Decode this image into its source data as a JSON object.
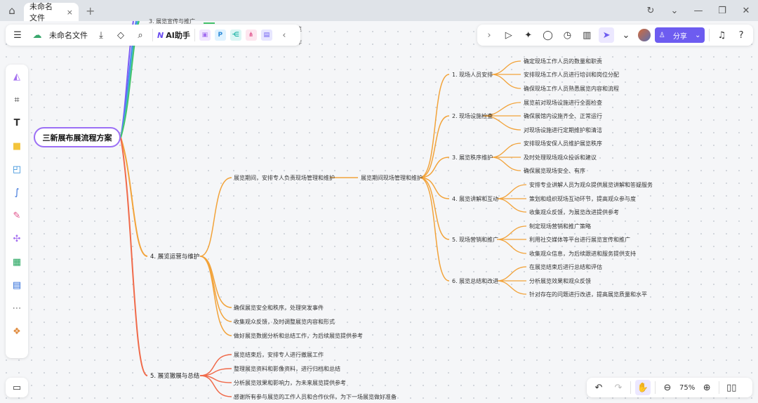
{
  "browser": {
    "tab_title": "未命名文件",
    "close_glyph": "×",
    "new_tab_glyph": "+"
  },
  "toolbar_left": {
    "menu_icon": "menu-icon",
    "file_title": "未命名文件",
    "ai_label": "AI助手",
    "ai_logo": "N"
  },
  "toolbar_right": {
    "share_label": "分享"
  },
  "zoom": {
    "level": "75%"
  },
  "mindmap": {
    "root": "三新展布展流程方案",
    "clipped": {
      "top_item_1": "3. 展览宣传与推广",
      "top_item_2_suffix": "览",
      "top_item_3_suffix": "作"
    },
    "branch4": {
      "label": "4. 展览运营与维护",
      "child_main": "展览期间，安排专人负责现场管理和维护",
      "child_mid": "展览期间现场管理和维护",
      "extra_children": [
        "确保展览安全和秩序，处理突发事件",
        "收集观众反馈，及时调整展览内容和形式",
        "做好展览数据分析和总结工作，为后续展览提供参考"
      ],
      "subsections": [
        {
          "label": "1. 现场人员安排",
          "items": [
            "确定现场工作人员的数量和职责",
            "安排现场工作人员进行培训和岗位分配",
            "确保现场工作人员熟悉展览内容和流程"
          ]
        },
        {
          "label": "2. 现场设施检查",
          "items": [
            "展览前对现场设施进行全面检查",
            "确保展馆内设施齐全、正常运行",
            "对现场设施进行定期维护和清洁"
          ]
        },
        {
          "label": "3. 展览秩序维护",
          "items": [
            "安排现场安保人员维护展览秩序",
            "及时处理现场观众投诉和建议",
            "确保展览现场安全、有序"
          ]
        },
        {
          "label": "4. 展览讲解和互动",
          "items": [
            "安排专业讲解人员为观众提供展览讲解和答疑服务",
            "策划和组织现场互动环节，提高观众参与度",
            "收集观众反馈，为展览改进提供参考"
          ]
        },
        {
          "label": "5. 现场营销和推广",
          "items": [
            "制定现场营销和推广策略",
            "利用社交媒体等平台进行展览宣传和推广",
            "收集观众信息，为后续跟进和服务提供支持"
          ]
        },
        {
          "label": "6. 展览总结和改进",
          "items": [
            "在展览结束后进行总结和评估",
            "分析展览效果和观众反馈",
            "针对存在的问题进行改进，提高展览质量和水平"
          ]
        }
      ]
    },
    "branch5": {
      "label": "5. 展览撤展与总结",
      "children": [
        "展览结束后，安排专人进行撤展工作",
        "整理展览资料和影像资料，进行归档和总结",
        "分析展览效果和影响力，为未来展览提供参考",
        "感谢所有参与展览的工作人员和合作伙伴，为下一场展览做好准备"
      ]
    }
  },
  "colors": {
    "accent": "#6d5cf0",
    "root_border": "#9b6ff5",
    "branch4_line": "#f2a33a",
    "branch5_line": "#f06a4a"
  }
}
